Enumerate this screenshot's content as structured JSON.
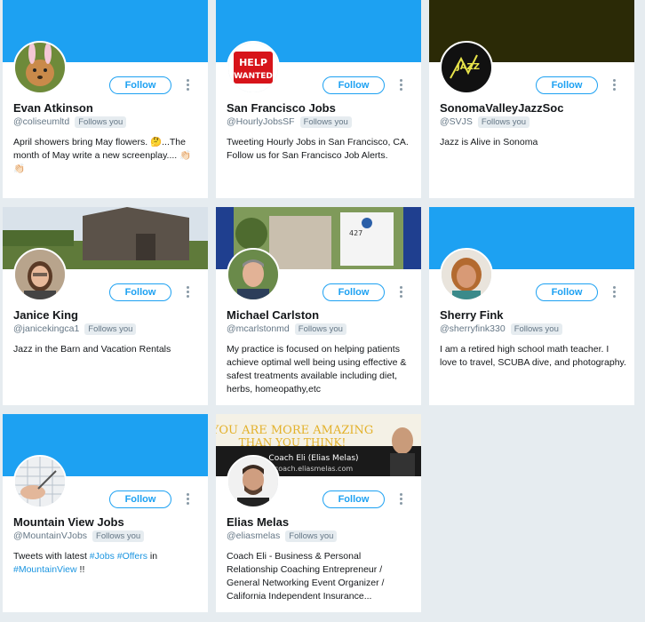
{
  "follow_label": "Follow",
  "follows_you_label": "Follows you",
  "colors": {
    "accent": "#1da1f2",
    "link": "#1b95e0",
    "background": "#e6ecf0",
    "muted": "#657786"
  },
  "cards": [
    {
      "name": "Evan Atkinson",
      "handle": "@coliseumltd",
      "bio": "April showers bring May flowers. 🤔...The month of May write a new screenplay.... 👏🏻👏🏻"
    },
    {
      "name": "San Francisco Jobs",
      "handle": "@HourlyJobsSF",
      "bio": "Tweeting Hourly Jobs in San Francisco, CA. Follow us for San Francisco Job Alerts."
    },
    {
      "name": "SonomaValleyJazzSoc",
      "handle": "@SVJS",
      "bio": "Jazz is Alive in Sonoma"
    },
    {
      "name": "Janice King",
      "handle": "@janicekingca1",
      "bio": "Jazz in the Barn and Vacation Rentals"
    },
    {
      "name": "Michael Carlston",
      "handle": "@mcarlstonmd",
      "bio": "My practice is focused on helping patients achieve optimal well being using effective & safest treatments available including diet, herbs, homeopathy,etc"
    },
    {
      "name": "Sherry Fink",
      "handle": "@sherryfink330",
      "bio": "I am a retired high school math teacher. I love to travel, SCUBA dive, and photography."
    },
    {
      "name": "Mountain View Jobs",
      "handle": "@MountainVJobs",
      "bio_parts": [
        "Tweets with latest ",
        "#Jobs",
        " ",
        "#Offers",
        " in ",
        "#MountainView",
        " !!"
      ]
    },
    {
      "name": "Elias Melas",
      "handle": "@eliasmelas",
      "bio": "Coach Eli - Business & Personal Relationship Coaching Entrepreneur / General Networking Event Organizer / California Independent Insurance...",
      "banner_text": {
        "line1": "YOU ARE MORE AMAZING",
        "line2": "THAN YOU THINK!",
        "line3": "Coach Eli (Elias Melas)",
        "line4": "coach.eliasmelas.com"
      }
    }
  ],
  "avatar_text": {
    "help_line1": "HELP",
    "help_line2": "WANTED",
    "jazz_logo": "JAZZ"
  },
  "office_sign_number": "427"
}
